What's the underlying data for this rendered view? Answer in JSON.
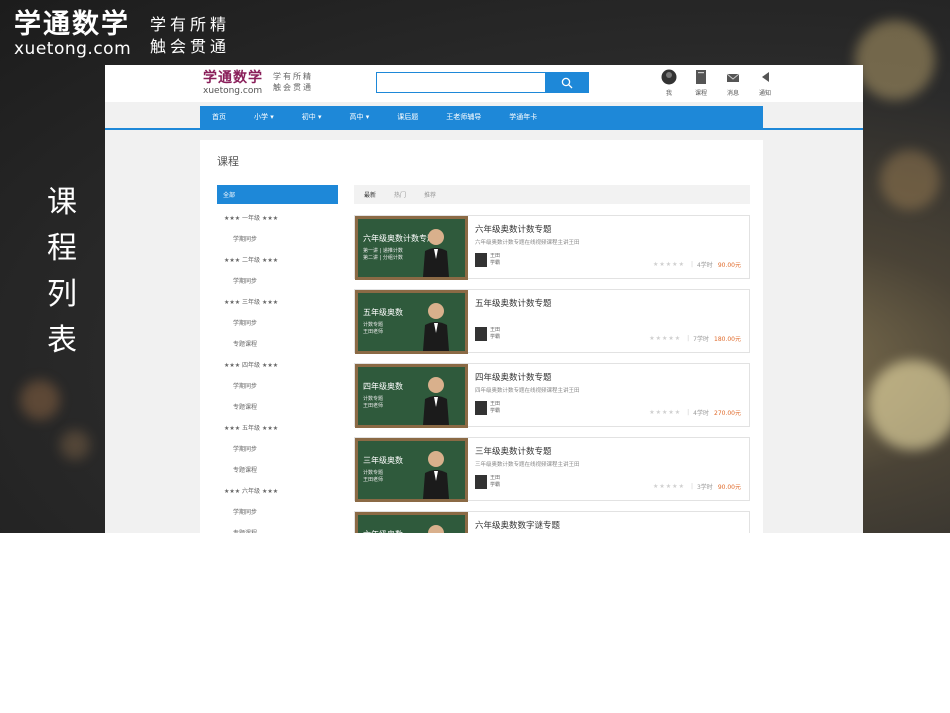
{
  "slide": {
    "brand_logo": "学通数学",
    "brand_domain": "xuetong.com",
    "brand_slogan_1": "学有所精",
    "brand_slogan_2": "触会贯通",
    "title_chars": [
      "课",
      "程",
      "列",
      "表"
    ]
  },
  "site": {
    "logo": "学通数学",
    "domain": "xuetong.com",
    "slogan_1": "学有所精",
    "slogan_2": "触会贯通",
    "search_placeholder": "",
    "tools": [
      {
        "label": "我",
        "icon": "avatar-icon"
      },
      {
        "label": "课程",
        "icon": "book-icon"
      },
      {
        "label": "消息",
        "icon": "mail-icon"
      },
      {
        "label": "通知",
        "icon": "speaker-icon"
      }
    ],
    "nav": [
      "首页",
      "小学 ▾",
      "初中 ▾",
      "高中 ▾",
      "课后题",
      "王老师辅导",
      "学通年卡"
    ]
  },
  "panel": {
    "title": "课程",
    "sidebar": [
      {
        "label": "全部",
        "type": "active"
      },
      {
        "label": "★★★ 一年级 ★★★",
        "type": "grade"
      },
      {
        "label": "学期同步",
        "type": "sub"
      },
      {
        "label": "★★★ 二年级 ★★★",
        "type": "grade"
      },
      {
        "label": "学期同步",
        "type": "sub"
      },
      {
        "label": "★★★ 三年级 ★★★",
        "type": "grade"
      },
      {
        "label": "学期同步",
        "type": "sub"
      },
      {
        "label": "专题课程",
        "type": "sub"
      },
      {
        "label": "★★★ 四年级 ★★★",
        "type": "grade"
      },
      {
        "label": "学期同步",
        "type": "sub"
      },
      {
        "label": "专题课程",
        "type": "sub"
      },
      {
        "label": "★★★ 五年级 ★★★",
        "type": "grade"
      },
      {
        "label": "学期同步",
        "type": "sub"
      },
      {
        "label": "专题课程",
        "type": "sub"
      },
      {
        "label": "★★★ 六年级 ★★★",
        "type": "grade"
      },
      {
        "label": "学期同步",
        "type": "sub"
      },
      {
        "label": "专题课程",
        "type": "sub"
      }
    ],
    "tabs": [
      "最新",
      "热门",
      "推荐"
    ],
    "courses": [
      {
        "thumb": "六年级奥数计数专题",
        "thumb_sub": "第一讲 | 递推计数\n第二讲 | 分组计数",
        "title": "六年级奥数计数专题",
        "desc": "六年级奥数计数专题在线视频课程主讲王田",
        "author1": "王田",
        "author2": "学霸",
        "stars": "★★★★★",
        "lessons": "4学时",
        "price": "90.00元"
      },
      {
        "thumb": "五年级奥数",
        "thumb_sub": "计数专题\n王田老师",
        "title": "五年级奥数计数专题",
        "desc": "",
        "author1": "王田",
        "author2": "学霸",
        "stars": "★★★★★",
        "lessons": "7学时",
        "price": "180.00元"
      },
      {
        "thumb": "四年级奥数",
        "thumb_sub": "计数专题\n王田老师",
        "title": "四年级奥数计数专题",
        "desc": "四年级奥数计数专题在线视频课程主讲王田",
        "author1": "王田",
        "author2": "学霸",
        "stars": "★★★★★",
        "lessons": "4学时",
        "price": "270.00元"
      },
      {
        "thumb": "三年级奥数",
        "thumb_sub": "计数专题\n王田老师",
        "title": "三年级奥数计数专题",
        "desc": "三年级奥数计数专题在线视频课程主讲王田",
        "author1": "王田",
        "author2": "学霸",
        "stars": "★★★★★",
        "lessons": "3学时",
        "price": "90.00元"
      },
      {
        "thumb": "六年级奥数",
        "thumb_sub": "",
        "title": "六年级奥数数字谜专题",
        "desc": "",
        "author1": "",
        "author2": "",
        "stars": "",
        "lessons": "",
        "price": ""
      }
    ]
  },
  "colors": {
    "accent": "#1e88d8",
    "price": "#e06a2a",
    "board": "#2f5a3c"
  }
}
